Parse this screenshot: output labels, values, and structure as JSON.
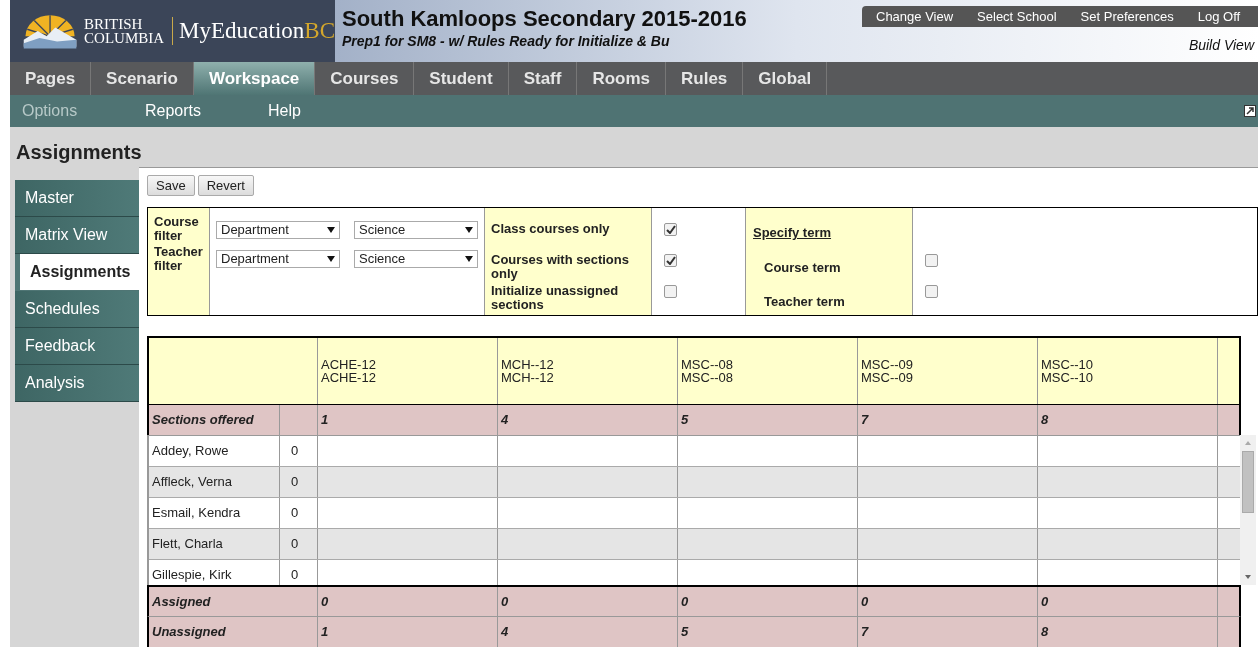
{
  "header": {
    "logo_line1": "BRITISH",
    "logo_line2": "COLUMBIA",
    "logo_brand": "MyEducation",
    "logo_brand_suffix": "BC",
    "title": "South Kamloops Secondary 2015-2016",
    "subtitle": "Prep1 for SM8 - w/ Rules Ready for Initialize & Bu",
    "user_links": [
      "Change View",
      "Select School",
      "Set Preferences",
      "Log Off"
    ],
    "view": "Build View"
  },
  "top_tabs": [
    {
      "label": "Pages",
      "selected": false
    },
    {
      "label": "Scenario",
      "selected": false
    },
    {
      "label": "Workspace",
      "selected": true
    },
    {
      "label": "Courses",
      "selected": false
    },
    {
      "label": "Student",
      "selected": false
    },
    {
      "label": "Staff",
      "selected": false
    },
    {
      "label": "Rooms",
      "selected": false
    },
    {
      "label": "Rules",
      "selected": false
    },
    {
      "label": "Global",
      "selected": false
    }
  ],
  "sub_menu": [
    {
      "label": "Options",
      "disabled": true
    },
    {
      "label": "Reports",
      "disabled": false
    },
    {
      "label": "Help",
      "disabled": false
    }
  ],
  "page_title": "Assignments",
  "side_tabs": [
    {
      "label": "Master",
      "selected": false
    },
    {
      "label": "Matrix View",
      "selected": false
    },
    {
      "label": "Assignments",
      "selected": true
    },
    {
      "label": "Schedules",
      "selected": false
    },
    {
      "label": "Feedback",
      "selected": false
    },
    {
      "label": "Analysis",
      "selected": false
    }
  ],
  "buttons": [
    "Save",
    "Revert"
  ],
  "filters": {
    "rows": [
      {
        "label": "Course filter",
        "field": "Department",
        "value": "Science"
      },
      {
        "label": "Teacher filter",
        "field": "Department",
        "value": "Science"
      }
    ],
    "options": [
      {
        "label": "Class courses only",
        "checked": true
      },
      {
        "label": "Courses with sections only",
        "checked": true
      },
      {
        "label": "Initialize unassigned sections",
        "checked": false
      }
    ],
    "term": {
      "link": "Specify term",
      "items": [
        {
          "label": "Course term",
          "checked": false
        },
        {
          "label": "Teacher term",
          "checked": false
        }
      ]
    }
  },
  "grid": {
    "columns": [
      {
        "lines": [
          "ACHE-12",
          "ACHE-12"
        ]
      },
      {
        "lines": [
          "MCH--12",
          "MCH--12"
        ]
      },
      {
        "lines": [
          "MSC--08",
          "MSC--08"
        ]
      },
      {
        "lines": [
          "MSC--09",
          "MSC--09"
        ]
      },
      {
        "lines": [
          "MSC--10",
          "MSC--10"
        ]
      }
    ],
    "sections_offered": {
      "label": "Sections offered",
      "values": [
        "1",
        "4",
        "5",
        "7",
        "8"
      ]
    },
    "teachers": [
      {
        "name": "Addey, Rowe",
        "count": "0"
      },
      {
        "name": "Affleck, Verna",
        "count": "0"
      },
      {
        "name": "Esmail, Kendra",
        "count": "0"
      },
      {
        "name": "Flett, Charla",
        "count": "0"
      },
      {
        "name": "Gillespie, Kirk",
        "count": "0"
      }
    ],
    "assigned": {
      "label": "Assigned",
      "values": [
        "0",
        "0",
        "0",
        "0",
        "0"
      ]
    },
    "unassigned": {
      "label": "Unassigned",
      "values": [
        "1",
        "4",
        "5",
        "7",
        "8"
      ]
    }
  }
}
